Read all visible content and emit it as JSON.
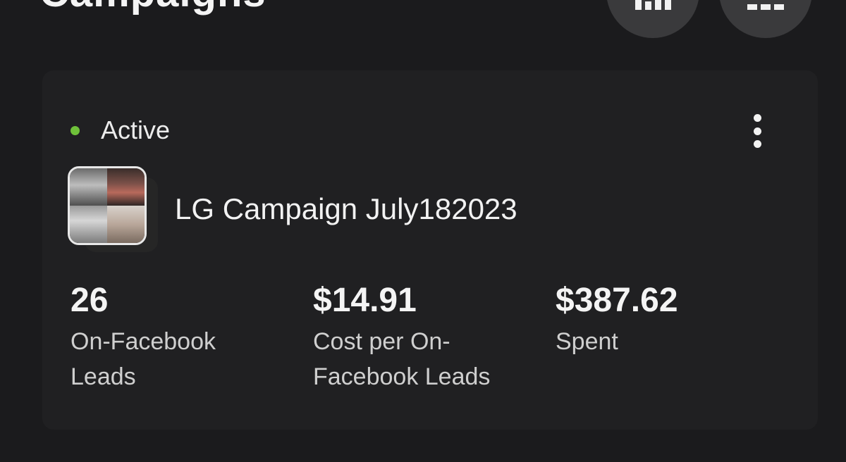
{
  "header": {
    "title": "Campaigns",
    "buttons": [
      {
        "name": "chart",
        "icon": "bar-chart-icon"
      },
      {
        "name": "columns",
        "icon": "columns-icon"
      }
    ]
  },
  "card": {
    "status": {
      "label": "Active",
      "color": "#6fc13a"
    },
    "more_icon": "more-vertical-icon",
    "campaign_name": "LG Campaign July182023",
    "metrics": [
      {
        "value": "26",
        "label": "On-Facebook Leads"
      },
      {
        "value": "$14.91",
        "label": "Cost per On-Facebook Leads"
      },
      {
        "value": "$387.62",
        "label": "Spent"
      }
    ]
  }
}
